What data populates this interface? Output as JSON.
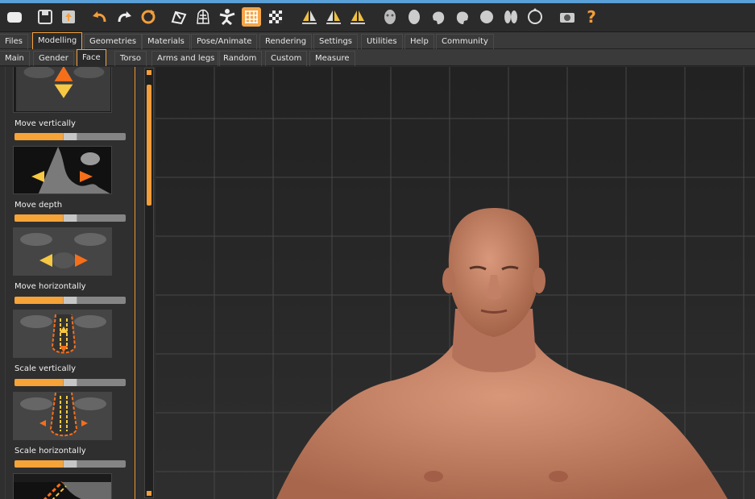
{
  "toolbar": {
    "icons": [
      "window-icon",
      "save-icon",
      "export-icon",
      "undo-icon",
      "redo-icon",
      "reset-icon",
      "smooth-icon",
      "wireframe-icon",
      "pose-icon",
      "grid-icon",
      "checker-icon",
      "symmetry-right-icon",
      "symmetry-left-icon",
      "symmetry-icon",
      "front-view-icon",
      "back-view-icon",
      "left-view-icon",
      "right-view-icon",
      "top-view-icon",
      "bottom-view-icon",
      "reset-camera-icon",
      "screenshot-icon",
      "help-icon"
    ],
    "help_label": "?"
  },
  "main_tabs": [
    "Files",
    "Modelling",
    "Geometries",
    "Materials",
    "Pose/Animate",
    "Rendering",
    "Settings",
    "Utilities",
    "Help",
    "Community"
  ],
  "main_tab_selected": "Modelling",
  "sub_tabs": [
    "Main",
    "Gender",
    "Face",
    "Torso",
    "Arms and legs",
    "Random",
    "Custom",
    "Measure"
  ],
  "sub_tab_selected": "Face",
  "sliders": [
    {
      "label": "Move vertically",
      "value": 0.5
    },
    {
      "label": "Move depth",
      "value": 0.5
    },
    {
      "label": "Move horizontally",
      "value": 0.5
    },
    {
      "label": "Scale vertically",
      "value": 0.5
    },
    {
      "label": "Scale horizontally",
      "value": 0.5
    }
  ],
  "colors": {
    "accent": "#f39d3b",
    "background": "#2a2a2a",
    "grid": "#4a4a4a",
    "skin": "#c98a6c"
  }
}
